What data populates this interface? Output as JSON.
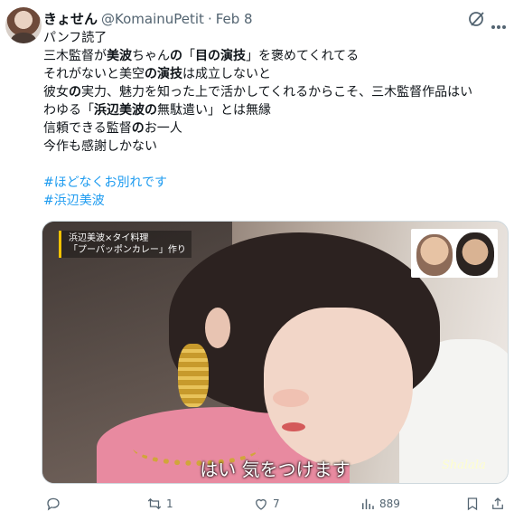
{
  "tweet": {
    "author": {
      "display_name": "きょせん",
      "handle": "@KomainuPetit",
      "separator": "·",
      "date": "Feb 8"
    },
    "lines": [
      [
        {
          "t": "パンフ読了",
          "b": false
        }
      ],
      [
        {
          "t": "三木監督が",
          "b": false
        },
        {
          "t": "美波",
          "b": true
        },
        {
          "t": "ちゃん",
          "b": false
        },
        {
          "t": "の",
          "b": true
        },
        {
          "t": "「",
          "b": false
        },
        {
          "t": "目の演技",
          "b": true
        },
        {
          "t": "」を褒めてくれてる",
          "b": false
        }
      ],
      [
        {
          "t": "それがないと美空",
          "b": false
        },
        {
          "t": "の演技",
          "b": true
        },
        {
          "t": "は成立しないと",
          "b": false
        }
      ],
      [
        {
          "t": "彼女",
          "b": false
        },
        {
          "t": "の",
          "b": true
        },
        {
          "t": "実力、魅力を知った上で活かしてくれるからこそ、三木監督作品はい",
          "b": false
        }
      ],
      [
        {
          "t": "わゆる「",
          "b": false
        },
        {
          "t": "浜辺美波の",
          "b": true
        },
        {
          "t": "無駄遣い」とは無縁",
          "b": false
        }
      ],
      [
        {
          "t": "信頼できる監督",
          "b": false
        },
        {
          "t": "の",
          "b": true
        },
        {
          "t": "お一人",
          "b": false
        }
      ],
      [
        {
          "t": "今作も感謝しかない",
          "b": false
        }
      ]
    ],
    "hashtags": [
      "#ほどなくお別れです",
      "#浜辺美波"
    ],
    "media": {
      "caption_line1": "浜辺美波×タイ料理",
      "caption_line2": "「プーパッポンカレー」作り",
      "subtitle": "はい 気をつけます",
      "watermark": "Shalala"
    },
    "actions": {
      "reply_count": "",
      "retweet_count": "1",
      "like_count": "7",
      "view_count": "889"
    },
    "icons": [
      "grok-icon",
      "more-icon",
      "reply-icon",
      "retweet-icon",
      "like-icon",
      "views-icon",
      "bookmark-icon",
      "share-icon"
    ],
    "colors": {
      "hashtag": "#1d9bf0",
      "muted": "#536471",
      "text": "#0f1419"
    }
  }
}
